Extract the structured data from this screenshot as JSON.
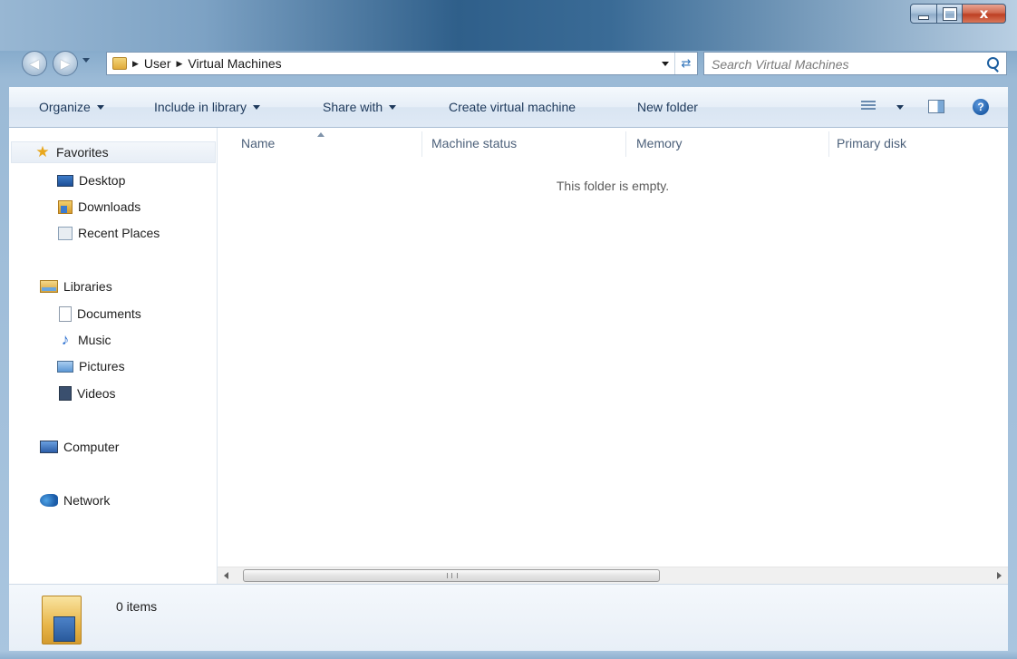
{
  "window": {
    "caption_close": "x"
  },
  "navigation": {
    "breadcrumbs": [
      "User",
      "Virtual Machines"
    ],
    "search_placeholder": "Search Virtual Machines"
  },
  "toolbar": {
    "organize": "Organize",
    "include_in_library": "Include in library",
    "share_with": "Share with",
    "create_vm": "Create virtual machine",
    "new_folder": "New folder",
    "help": "?"
  },
  "sidebar": {
    "favorites": {
      "label": "Favorites",
      "items": [
        "Desktop",
        "Downloads",
        "Recent Places"
      ]
    },
    "libraries": {
      "label": "Libraries",
      "items": [
        "Documents",
        "Music",
        "Pictures",
        "Videos"
      ]
    },
    "computer": "Computer",
    "network": "Network"
  },
  "file_list": {
    "columns": [
      "Name",
      "Machine status",
      "Memory",
      "Primary disk"
    ],
    "empty_message": "This folder is empty.",
    "scroll_grip": "III"
  },
  "details_pane": {
    "item_count": "0 items"
  }
}
